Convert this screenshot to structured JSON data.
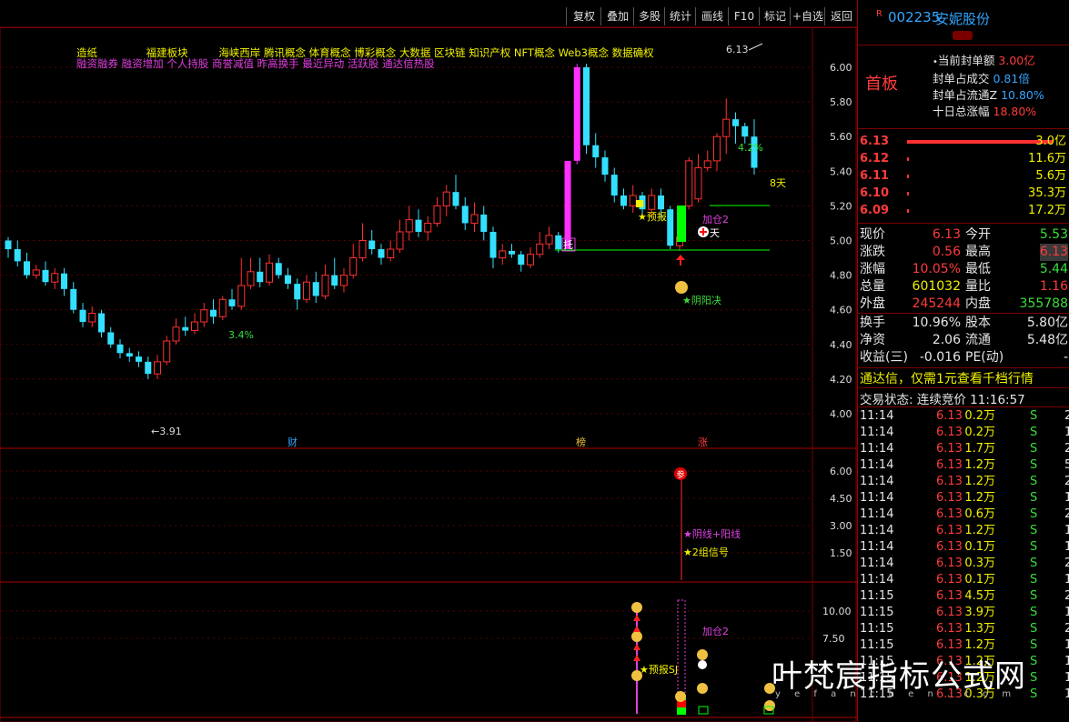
{
  "toolbar": {
    "buttons": [
      "复权",
      "叠加",
      "多股",
      "统计",
      "画线",
      "F10",
      "标记",
      "+自选",
      "返回"
    ]
  },
  "stock": {
    "badge": "R",
    "code": "002235",
    "name": "安妮股份",
    "status": "首板"
  },
  "seal_info": [
    {
      "label": "当前封单额",
      "value": "3.00亿"
    },
    {
      "label": "封单占成交",
      "value": "0.81倍"
    },
    {
      "label": "封单占流通Z",
      "value": "10.80%"
    },
    {
      "label": "十日总涨幅",
      "value": "18.80%"
    }
  ],
  "order_book": [
    {
      "price": "6.13",
      "bar": 160,
      "vol": "3.0亿"
    },
    {
      "price": "6.12",
      "bar": 2,
      "vol": "11.6万"
    },
    {
      "price": "6.11",
      "bar": 2,
      "vol": "5.6万"
    },
    {
      "price": "6.10",
      "bar": 2,
      "vol": "35.3万"
    },
    {
      "price": "6.09",
      "bar": 2,
      "vol": "17.2万"
    }
  ],
  "quote": [
    {
      "l1": "现价",
      "v1": "6.13",
      "c1": "red",
      "l2": "今开",
      "v2": "5.53",
      "c2": "green"
    },
    {
      "l1": "涨跌",
      "v1": "0.56",
      "c1": "red",
      "l2": "最高",
      "v2": "6.13",
      "c2": "red"
    },
    {
      "l1": "涨幅",
      "v1": "10.05%",
      "c1": "red",
      "l2": "最低",
      "v2": "5.44",
      "c2": "green"
    },
    {
      "l1": "总量",
      "v1": "601032",
      "c1": "yellow",
      "l2": "量比",
      "v2": "1.16",
      "c2": "red"
    },
    {
      "l1": "外盘",
      "v1": "245244",
      "c1": "red",
      "l2": "内盘",
      "v2": "355788",
      "c2": "green"
    }
  ],
  "quote2": [
    {
      "l1": "换手",
      "v1": "10.96%",
      "l2": "股本",
      "v2": "5.80亿"
    },
    {
      "l1": "净资",
      "v1": "2.06",
      "l2": "流通",
      "v2": "5.48亿"
    },
    {
      "l1": "收益(三)",
      "v1": "-0.016",
      "l2": "PE(动)",
      "v2": "-"
    }
  ],
  "promo": "通达信，仅需1元查看千档行情",
  "trade_status": {
    "label": "交易状态: 连续竞价",
    "time": "11:16:57"
  },
  "ticks": [
    {
      "t": "11:14",
      "p": "6.13",
      "v": "0.2万",
      "s": "S",
      "n": "2"
    },
    {
      "t": "11:14",
      "p": "6.13",
      "v": "0.2万",
      "s": "S",
      "n": "1"
    },
    {
      "t": "11:14",
      "p": "6.13",
      "v": "1.7万",
      "s": "S",
      "n": "2"
    },
    {
      "t": "11:14",
      "p": "6.13",
      "v": "1.2万",
      "s": "S",
      "n": "5"
    },
    {
      "t": "11:14",
      "p": "6.13",
      "v": "1.2万",
      "s": "S",
      "n": "2"
    },
    {
      "t": "11:14",
      "p": "6.13",
      "v": "1.2万",
      "s": "S",
      "n": "1"
    },
    {
      "t": "11:14",
      "p": "6.13",
      "v": "0.6万",
      "s": "S",
      "n": "2"
    },
    {
      "t": "11:14",
      "p": "6.13",
      "v": "1.2万",
      "s": "S",
      "n": "1"
    },
    {
      "t": "11:14",
      "p": "6.13",
      "v": "0.1万",
      "s": "S",
      "n": "1"
    },
    {
      "t": "11:14",
      "p": "6.13",
      "v": "0.3万",
      "s": "S",
      "n": "2"
    },
    {
      "t": "11:14",
      "p": "6.13",
      "v": "0.1万",
      "s": "S",
      "n": "1"
    },
    {
      "t": "11:15",
      "p": "6.13",
      "v": "4.5万",
      "s": "S",
      "n": "2"
    },
    {
      "t": "11:15",
      "p": "6.13",
      "v": "3.9万",
      "s": "S",
      "n": "1"
    },
    {
      "t": "11:15",
      "p": "6.13",
      "v": "1.3万",
      "s": "S",
      "n": "2"
    },
    {
      "t": "11:15",
      "p": "6.13",
      "v": "1.2万",
      "s": "S",
      "n": "1"
    },
    {
      "t": "11:15",
      "p": "6.13",
      "v": "1.2万",
      "s": "S",
      "n": "1"
    },
    {
      "t": "11:15",
      "p": "6.13",
      "v": "1.2万",
      "s": "S",
      "n": "1"
    },
    {
      "t": "11:15",
      "p": "6.13",
      "v": "0.3万",
      "s": "S",
      "n": "1"
    }
  ],
  "concepts": {
    "row1": [
      "造纸",
      "福建板块",
      "海峡西岸",
      "腾讯概念",
      "体育概念",
      "博彩概念",
      "大数据",
      "区块链",
      "知识产权",
      "NFT概念",
      "Web3概念",
      "数据确权"
    ],
    "row2": [
      "融资融券",
      "融资增加",
      "个人持股",
      "商誉减值",
      "昨高换手",
      "最近异动",
      "活跃股",
      "通达信热股"
    ]
  },
  "chart_data": {
    "type": "candlestick",
    "price_axis": [
      "6.00",
      "5.80",
      "5.60",
      "5.40",
      "5.20",
      "5.00",
      "4.80",
      "4.60",
      "4.40",
      "4.20",
      "4.00"
    ],
    "ind1_axis": [
      "6.00",
      "4.50",
      "3.00",
      "1.50"
    ],
    "ind2_axis": [
      "10.00",
      "7.50"
    ],
    "labels": {
      "high": "6.13",
      "low": "3.91",
      "pct1": "4.2%",
      "pct2": "3.4%",
      "days": "8天",
      "yubao": "★预报",
      "jiacang": "加仓2",
      "tian": "天",
      "yinyang": "★阴阳决",
      "tuo": "托",
      "cai": "财",
      "bang": "榜",
      "zhang": "涨",
      "sig1": "★阴线+阳线",
      "sig2": "★2组信号",
      "can": "参",
      "yubaosj": "★预报SJ",
      "jiacang2": "加仓2"
    },
    "candles": [
      [
        5.0,
        4.95,
        5.02,
        4.9
      ],
      [
        4.95,
        4.88,
        5.0,
        4.85
      ],
      [
        4.88,
        4.8,
        4.93,
        4.78
      ],
      [
        4.8,
        4.83,
        4.86,
        4.78
      ],
      [
        4.83,
        4.76,
        4.88,
        4.74
      ],
      [
        4.76,
        4.81,
        4.84,
        4.72
      ],
      [
        4.81,
        4.72,
        4.84,
        4.68
      ],
      [
        4.72,
        4.6,
        4.76,
        4.58
      ],
      [
        4.6,
        4.53,
        4.64,
        4.5
      ],
      [
        4.53,
        4.58,
        4.62,
        4.5
      ],
      [
        4.58,
        4.47,
        4.6,
        4.44
      ],
      [
        4.47,
        4.4,
        4.5,
        4.38
      ],
      [
        4.4,
        4.35,
        4.43,
        4.32
      ],
      [
        4.35,
        4.33,
        4.38,
        4.3
      ],
      [
        4.33,
        4.3,
        4.36,
        4.27
      ],
      [
        4.3,
        4.23,
        4.33,
        4.2
      ],
      [
        4.23,
        4.3,
        4.34,
        4.2
      ],
      [
        4.3,
        4.42,
        4.45,
        4.28
      ],
      [
        4.42,
        4.5,
        4.55,
        4.4
      ],
      [
        4.5,
        4.48,
        4.56,
        4.45
      ],
      [
        4.48,
        4.53,
        4.58,
        4.46
      ],
      [
        4.53,
        4.6,
        4.64,
        4.5
      ],
      [
        4.6,
        4.56,
        4.66,
        4.52
      ],
      [
        4.56,
        4.66,
        4.68,
        4.54
      ],
      [
        4.66,
        4.62,
        4.72,
        4.6
      ],
      [
        4.62,
        4.74,
        4.9,
        4.6
      ],
      [
        4.74,
        4.82,
        4.9,
        4.72
      ],
      [
        4.82,
        4.76,
        4.9,
        4.73
      ],
      [
        4.76,
        4.87,
        4.92,
        4.74
      ],
      [
        4.87,
        4.8,
        4.9,
        4.78
      ],
      [
        4.8,
        4.75,
        4.84,
        4.72
      ],
      [
        4.75,
        4.66,
        4.78,
        4.6
      ],
      [
        4.66,
        4.76,
        4.8,
        4.64
      ],
      [
        4.76,
        4.68,
        4.82,
        4.64
      ],
      [
        4.68,
        4.8,
        4.86,
        4.66
      ],
      [
        4.8,
        4.74,
        4.9,
        4.72
      ],
      [
        4.74,
        4.8,
        4.84,
        4.7
      ],
      [
        4.8,
        4.9,
        4.98,
        4.78
      ],
      [
        4.9,
        5.0,
        5.1,
        4.88
      ],
      [
        5.0,
        4.95,
        5.06,
        4.92
      ],
      [
        4.95,
        4.9,
        4.98,
        4.86
      ],
      [
        4.9,
        4.95,
        5.0,
        4.88
      ],
      [
        4.95,
        5.05,
        5.12,
        4.93
      ],
      [
        5.05,
        5.12,
        5.2,
        5.0
      ],
      [
        5.12,
        5.05,
        5.18,
        5.02
      ],
      [
        5.05,
        5.1,
        5.14,
        5.0
      ],
      [
        5.1,
        5.2,
        5.25,
        5.08
      ],
      [
        5.2,
        5.28,
        5.32,
        5.14
      ],
      [
        5.28,
        5.2,
        5.38,
        5.18
      ],
      [
        5.2,
        5.1,
        5.25,
        5.06
      ],
      [
        5.1,
        5.15,
        5.22,
        5.05
      ],
      [
        5.15,
        5.05,
        5.2,
        5.0
      ],
      [
        5.05,
        4.9,
        5.08,
        4.84
      ],
      [
        4.9,
        4.94,
        4.98,
        4.86
      ],
      [
        4.94,
        4.92,
        4.98,
        4.9
      ],
      [
        4.92,
        4.86,
        4.94,
        4.82
      ],
      [
        4.86,
        4.92,
        4.96,
        4.84
      ],
      [
        4.92,
        4.98,
        5.05,
        4.9
      ],
      [
        4.98,
        5.03,
        5.08,
        4.95
      ],
      [
        5.03,
        4.95,
        5.05,
        4.93
      ],
      [
        4.95,
        5.46,
        5.46,
        4.95
      ],
      [
        5.46,
        6.0,
        6.02,
        5.44
      ],
      [
        6.0,
        5.55,
        6.02,
        5.5
      ],
      [
        5.55,
        5.48,
        5.62,
        5.42
      ],
      [
        5.48,
        5.38,
        5.52,
        5.34
      ],
      [
        5.38,
        5.26,
        5.42,
        5.22
      ],
      [
        5.26,
        5.2,
        5.3,
        5.18
      ],
      [
        5.2,
        5.26,
        5.32,
        5.16
      ],
      [
        5.26,
        5.18,
        5.28,
        5.14
      ],
      [
        5.18,
        5.26,
        5.3,
        5.14
      ],
      [
        5.26,
        5.18,
        5.3,
        5.12
      ],
      [
        5.18,
        4.97,
        5.2,
        4.95
      ],
      [
        4.97,
        5.02,
        5.06,
        4.94
      ],
      [
        5.2,
        5.46,
        5.48,
        5.18
      ],
      [
        5.24,
        5.42,
        5.5,
        5.22
      ],
      [
        5.42,
        5.46,
        5.52,
        5.4
      ],
      [
        5.46,
        5.6,
        5.62,
        5.4
      ],
      [
        5.6,
        5.7,
        5.82,
        5.5
      ],
      [
        5.7,
        5.66,
        5.74,
        5.56
      ],
      [
        5.66,
        5.6,
        5.68,
        5.56
      ],
      [
        5.6,
        5.42,
        5.7,
        5.38
      ]
    ]
  }
}
